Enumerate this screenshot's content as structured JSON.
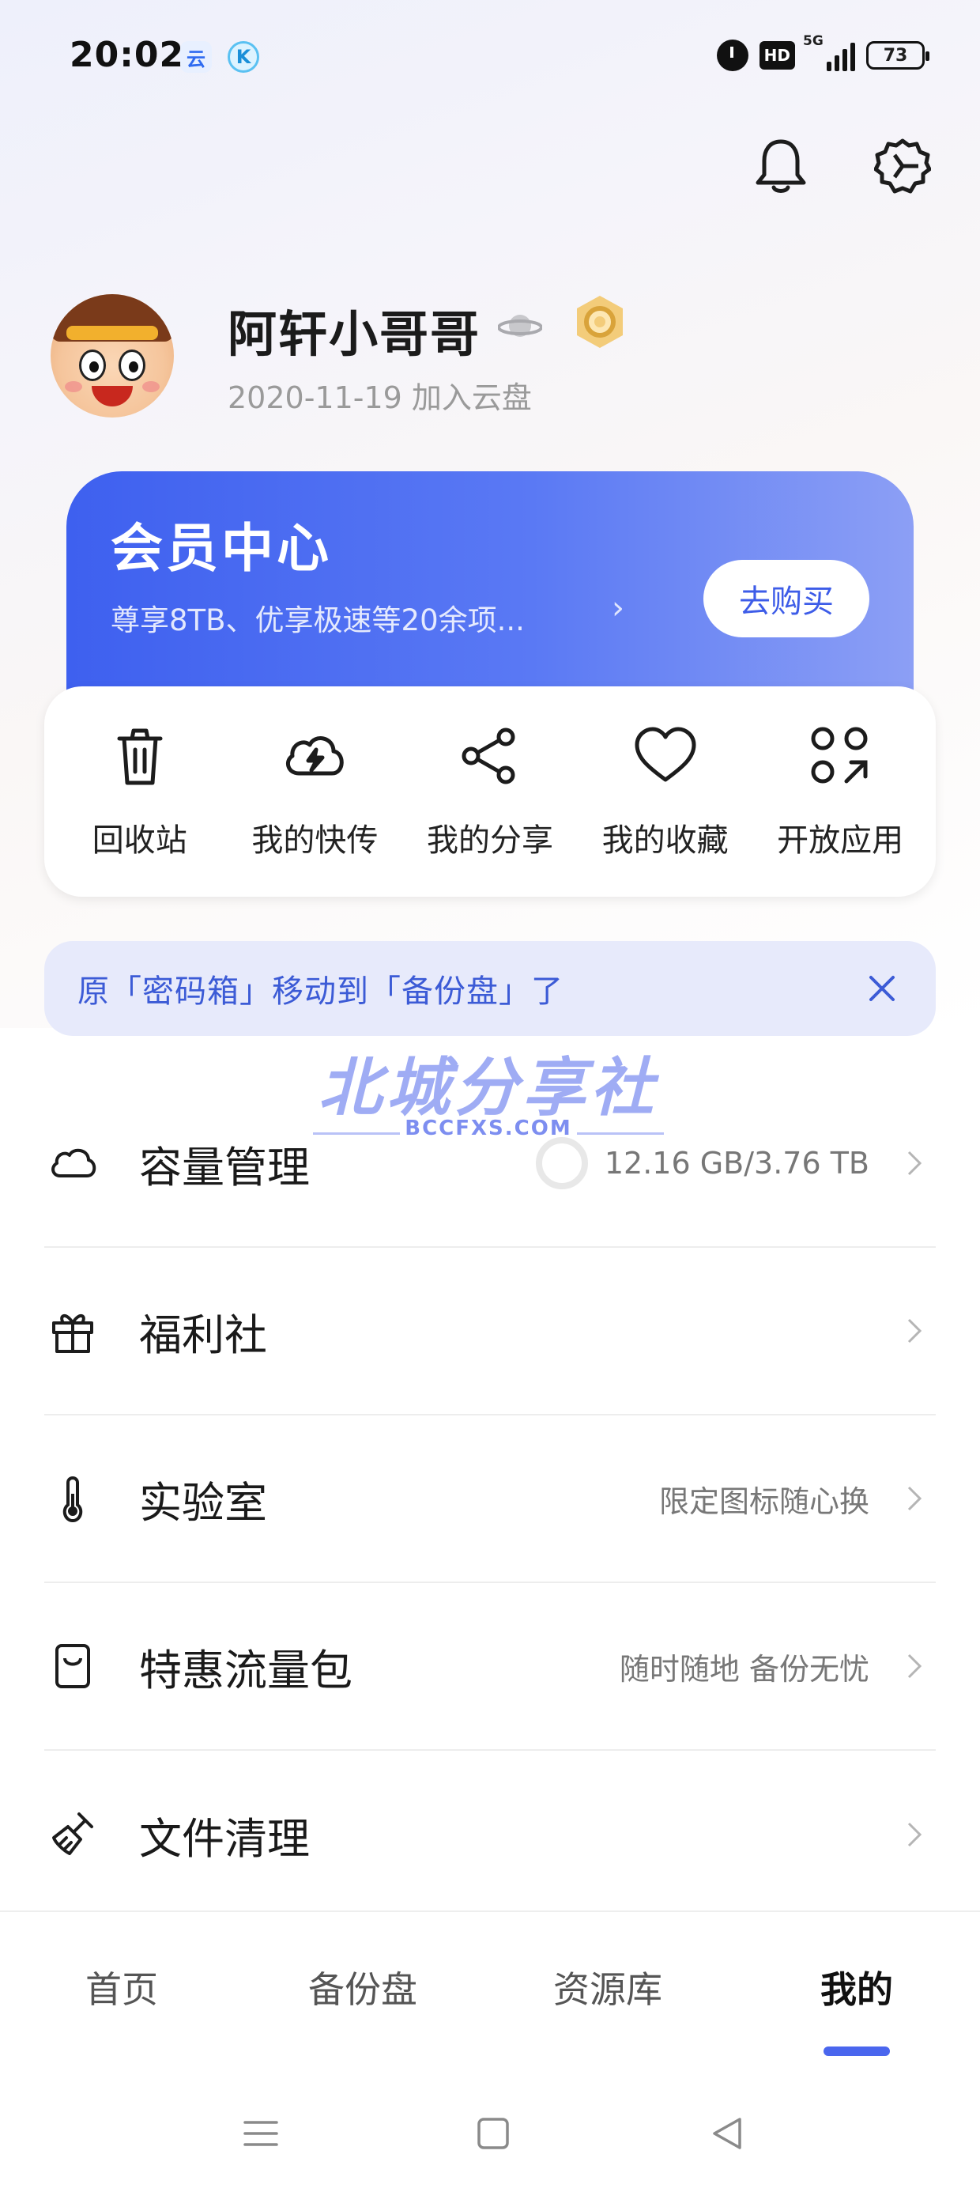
{
  "status_bar": {
    "time": "20:02",
    "app_icon_1": "云",
    "app_icon_2": "K",
    "network_hd": "HD",
    "network_type": "5G",
    "battery": "73"
  },
  "header": {
    "icons": [
      "bell-icon",
      "settings-icon"
    ]
  },
  "profile": {
    "name": "阿轩小哥哥",
    "join_date": "2020-11-19 加入云盘"
  },
  "member_card": {
    "title": "会员中心",
    "description": "尊享8TB、优享极速等20余项...",
    "buy_label": "去购买"
  },
  "quick_actions": [
    {
      "label": "回收站",
      "icon": "trash-icon"
    },
    {
      "label": "我的快传",
      "icon": "cloud-flash-icon"
    },
    {
      "label": "我的分享",
      "icon": "share-icon"
    },
    {
      "label": "我的收藏",
      "icon": "heart-icon"
    },
    {
      "label": "开放应用",
      "icon": "apps-icon"
    }
  ],
  "notice": {
    "text": "原「密码箱」移动到「备份盘」了"
  },
  "watermark": {
    "main": "北城分享社",
    "sub": "BCCFXS.COM"
  },
  "menu": [
    {
      "label": "容量管理",
      "value": "12.16 GB/3.76 TB",
      "icon": "cloud-icon"
    },
    {
      "label": "福利社",
      "value": "",
      "icon": "gift-icon"
    },
    {
      "label": "实验室",
      "value": "限定图标随心换",
      "icon": "thermometer-icon"
    },
    {
      "label": "特惠流量包",
      "value": "随时随地 备份无忧",
      "icon": "data-pack-icon"
    },
    {
      "label": "文件清理",
      "value": "",
      "icon": "broom-icon"
    }
  ],
  "bottom_nav": {
    "tabs": [
      "首页",
      "备份盘",
      "资源库",
      "我的"
    ],
    "active": "我的"
  },
  "colors": {
    "accent": "#3e60ef",
    "notice_bg": "#e7eafb",
    "notice_text": "#3c5bd6"
  }
}
